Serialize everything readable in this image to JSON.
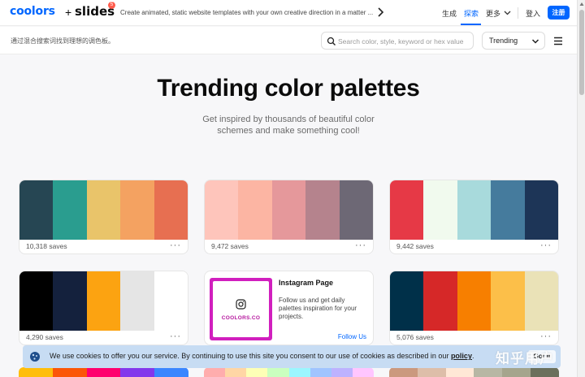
{
  "topbar": {
    "logo": "coolors",
    "plus": "+",
    "slides": "slides",
    "slides_badge": "5",
    "promo": "Create animated, static website templates with your own creative direction in a matter ...",
    "nav": {
      "generate": "生成",
      "explore": "探索",
      "more": "更多",
      "login": "登入",
      "signup": "注册"
    }
  },
  "subbar": {
    "hint": "通过混合搜索词找到理想的调色板。",
    "search_placeholder": "Search color, style, keyword or hex value",
    "sort_selected": "Trending"
  },
  "hero": {
    "title": "Trending color palettes",
    "subtitle": "Get inspired by thousands of beautiful color schemes and make something cool!"
  },
  "palettes": [
    {
      "colors": [
        "#264653",
        "#2a9d8f",
        "#e9c46a",
        "#f4a261",
        "#e76f51"
      ],
      "saves": "10,318 saves"
    },
    {
      "colors": [
        "#fec5bb",
        "#fcb5a3",
        "#e5989b",
        "#b5838d",
        "#6d6875"
      ],
      "saves": "9,472 saves"
    },
    {
      "colors": [
        "#e63946",
        "#f1faee",
        "#a8dadc",
        "#457b9d",
        "#1d3557"
      ],
      "saves": "9,442 saves"
    },
    {
      "colors": [
        "#000000",
        "#14213d",
        "#fca311",
        "#e5e5e5",
        "#ffffff"
      ],
      "saves": "4,290 saves"
    },
    {
      "colors": [
        "#003049",
        "#d62828",
        "#f77f00",
        "#fcbf49",
        "#eae2b7"
      ],
      "saves": "5,076 saves"
    }
  ],
  "instagram": {
    "title": "Instagram Page",
    "description": "Follow us and get daily palettes inspiration for your projects.",
    "brand": "COOLORS.CO",
    "link": "Follow Us"
  },
  "bottom_palettes": [
    [
      "#ffbe0b",
      "#fb5607",
      "#ff006e",
      "#8338ec",
      "#3a86ff"
    ],
    [
      "#ffadad",
      "#ffd6a5",
      "#fdffb6",
      "#caffbf",
      "#9bf6ff",
      "#a0c4ff",
      "#bdb2ff",
      "#ffc6ff"
    ],
    [
      "#cb997e",
      "#ddbea9",
      "#ffe8d6",
      "#b7b7a4",
      "#a5a58d",
      "#6b705c"
    ]
  ],
  "cookie": {
    "text": "We use cookies to offer you our service. By continuing to use this site you consent to our use of cookies as described in our ",
    "policy": "policy",
    "punct": ".",
    "button": "Got it"
  },
  "watermark": "知乎用户",
  "colors": {
    "accent": "#0066ff",
    "banner": "#c7dcf3",
    "ig_border": "#d11fbe"
  }
}
